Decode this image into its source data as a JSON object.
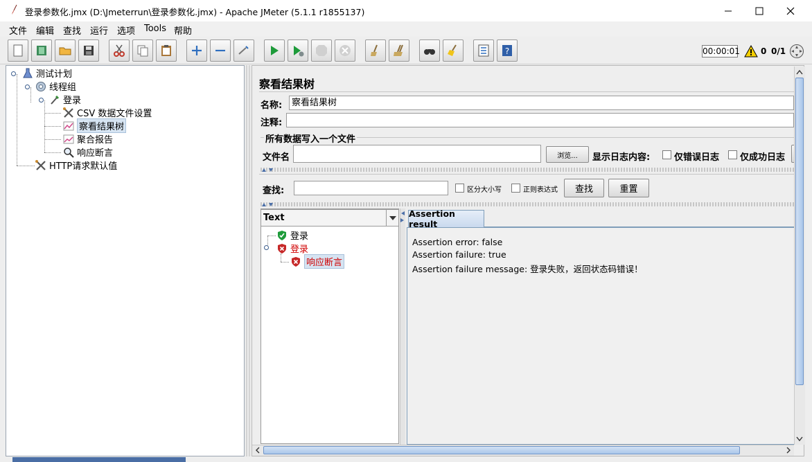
{
  "window": {
    "title": "登录参数化.jmx (D:\\Jmeterrun\\登录参数化.jmx) - Apache JMeter (5.1.1 r1855137)"
  },
  "menu": [
    "文件",
    "编辑",
    "查找",
    "运行",
    "选项",
    "Tools",
    "帮助"
  ],
  "status": {
    "timer": "00:00:01",
    "warnings": "0",
    "threads": "0/1"
  },
  "tree": [
    {
      "label": "测试计划",
      "icon": "flask-icon"
    },
    {
      "label": "线程组",
      "icon": "gear-icon"
    },
    {
      "label": "登录",
      "icon": "pipette-icon"
    },
    {
      "label": "CSV 数据文件设置",
      "icon": "tools-icon"
    },
    {
      "label": "察看结果树",
      "icon": "chart-icon"
    },
    {
      "label": "聚合报告",
      "icon": "chart-icon"
    },
    {
      "label": "响应断言",
      "icon": "magnifier-icon"
    },
    {
      "label": "HTTP请求默认值",
      "icon": "tools-icon"
    }
  ],
  "panel": {
    "title": "察看结果树",
    "name_label": "名称:",
    "name_value": "察看结果树",
    "comment_label": "注释:",
    "comment_value": "",
    "fieldset_legend": "所有数据写入一个文件",
    "filename_label": "文件名",
    "filename_value": "",
    "browse_button": "浏览...",
    "log_display_label": "显示日志内容:",
    "errors_only_label": "仅错误日志",
    "success_only_label": "仅成功日志",
    "search_label": "查找:",
    "search_value": "",
    "case_sensitive_label": "区分大小写",
    "regex_label": "正则表达式",
    "search_button": "查找",
    "reset_button": "重置",
    "renderer_selected": "Text",
    "results": [
      {
        "label": "登录",
        "status": "success"
      },
      {
        "label": "登录",
        "status": "failure"
      },
      {
        "label": "响应断言",
        "status": "failure"
      }
    ],
    "detail_tab": "Assertion result",
    "assertion": {
      "error": "Assertion error: false",
      "failure": "Assertion failure: true",
      "message": "Assertion failure message: 登录失败，返回状态码错误！"
    }
  },
  "colors": {
    "failure_text": "#d00000",
    "tab_border": "#7f9db9",
    "selection": "#d6e4f2"
  }
}
